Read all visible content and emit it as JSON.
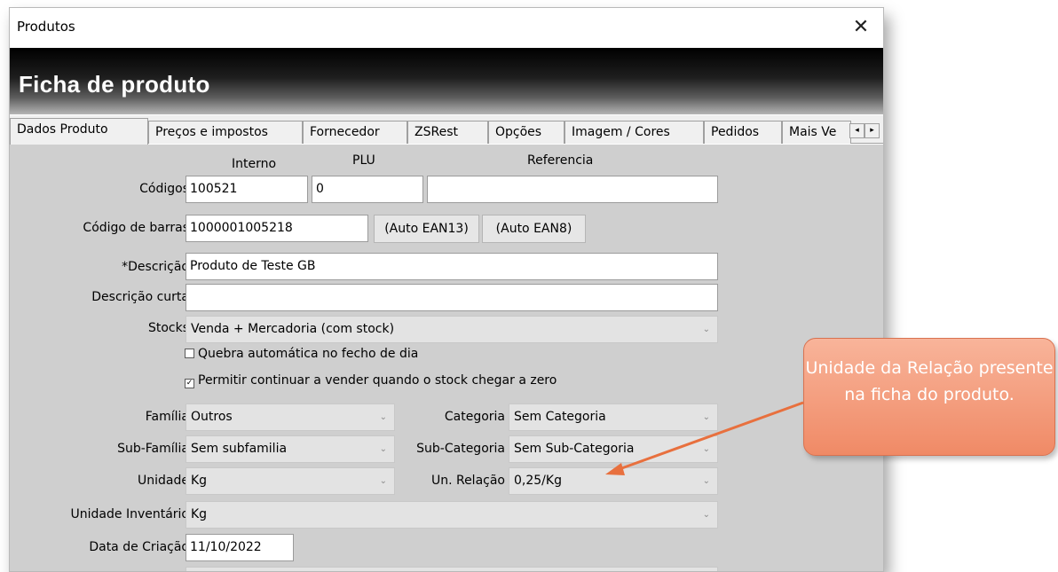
{
  "window": {
    "title": "Produtos"
  },
  "header": {
    "title": "Ficha de produto"
  },
  "tabs": [
    {
      "label": "Dados Produto"
    },
    {
      "label": "Preços e impostos"
    },
    {
      "label": "Fornecedor"
    },
    {
      "label": "ZSRest"
    },
    {
      "label": "Opções"
    },
    {
      "label": "Imagem / Cores"
    },
    {
      "label": "Pedidos"
    },
    {
      "label": "Mais Ve"
    }
  ],
  "form": {
    "col_headers": {
      "interno": "Interno",
      "plu": "PLU",
      "referencia": "Referencia"
    },
    "codigos": {
      "label": "Códigos",
      "interno": "100521",
      "plu": "0",
      "referencia": ""
    },
    "barras": {
      "label": "Código de barras",
      "value": "1000001005218",
      "btn_ean13": "(Auto EAN13)",
      "btn_ean8": "(Auto EAN8)"
    },
    "descricao": {
      "label": "*Descrição",
      "value": "Produto de Teste GB"
    },
    "descricao_curta": {
      "label": "Descrição curta",
      "value": ""
    },
    "stocks": {
      "label": "Stocks",
      "value": "Venda + Mercadoria (com stock)"
    },
    "quebra": {
      "label": "Quebra automática no fecho de dia",
      "checked": false
    },
    "permitir": {
      "label": "Permitir continuar a vender quando o stock chegar a zero",
      "checked": true
    },
    "familia": {
      "label": "Família",
      "value": "Outros"
    },
    "categoria": {
      "label": "Categoria",
      "value": "Sem Categoria"
    },
    "subfamilia": {
      "label": "Sub-Família",
      "value": "Sem subfamilia"
    },
    "subcategoria": {
      "label": "Sub-Categoria",
      "value": "Sem Sub-Categoria"
    },
    "unidade": {
      "label": "Unidade",
      "value": "Kg"
    },
    "unrelacao": {
      "label": "Un. Relação",
      "value": "0,25/Kg"
    },
    "unidade_inventario": {
      "label": "Unidade Inventário",
      "value": "Kg"
    },
    "data_criacao": {
      "label": "Data de Criação",
      "value": "11/10/2022"
    }
  },
  "callout": {
    "text": "Unidade da Relação presente na ficha do produto."
  },
  "icons": {
    "close": "close-icon",
    "chevron": "chevron-down-icon",
    "tab_left": "tab-scroll-left-icon",
    "tab_right": "tab-scroll-right-icon"
  },
  "colors": {
    "header_band": "#000000",
    "content_bg": "#cfcfcf",
    "callout": "#f08a66",
    "arrow": "#e8703e"
  }
}
